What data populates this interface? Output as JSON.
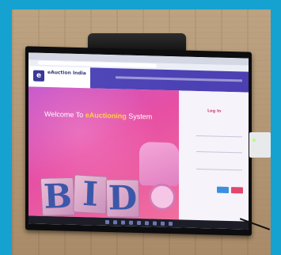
{
  "screen": {
    "brand": "eAuction India",
    "welcome_prefix": "Welcome To",
    "welcome_highlight": "eAuctioning",
    "welcome_suffix": "System",
    "blocks": [
      "B",
      "I",
      "D"
    ],
    "login_title": "Log In"
  },
  "colors": {
    "frame": "#15a2d0",
    "header": "#4f46b8",
    "banner_pink": "#e74fa3",
    "highlight": "#ffd23a",
    "login_title": "#d2446f",
    "button_blue": "#3c8fe0",
    "button_red": "#e2466d"
  }
}
